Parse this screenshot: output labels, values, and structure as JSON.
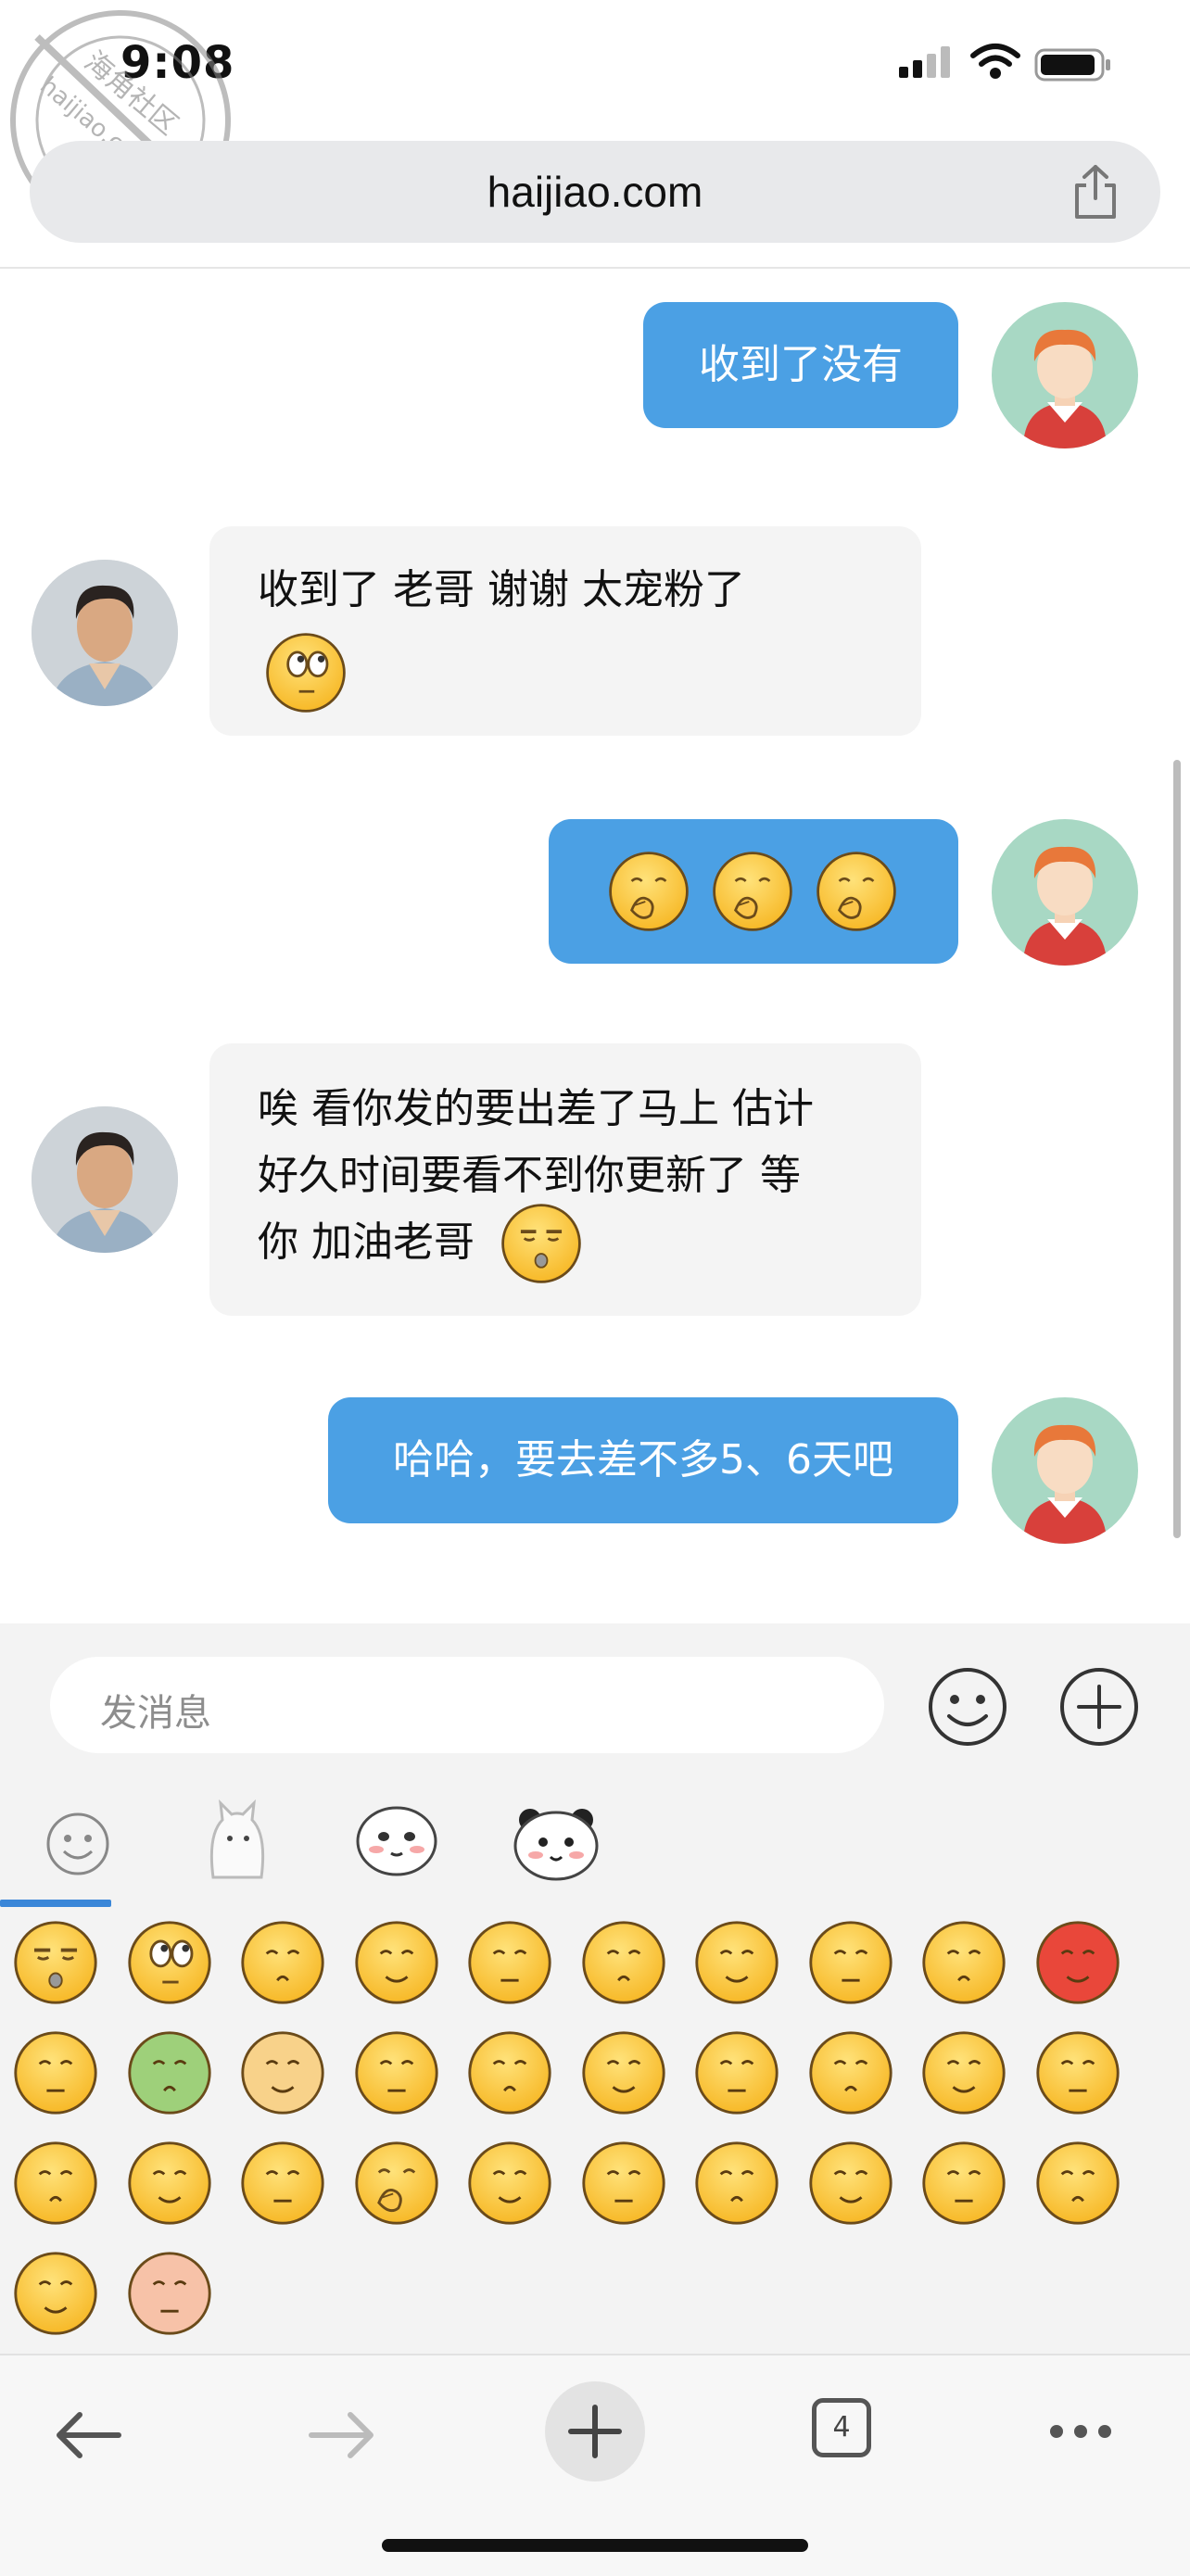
{
  "status_bar": {
    "time": "9:08"
  },
  "watermark": {
    "text": "海角社区 haijiao.com"
  },
  "browser": {
    "url": "haijiao.com",
    "tab_count": "4"
  },
  "messages": [
    {
      "from": "me",
      "text": "收到了没有",
      "emojis": []
    },
    {
      "from": "them",
      "text": "收到了 老哥 谢谢 太宠粉了",
      "emojis": [
        "rolling-eyes-emoji"
      ]
    },
    {
      "from": "me",
      "text": "",
      "emojis": [
        "shy-laugh-emoji",
        "shy-laugh-emoji",
        "shy-laugh-emoji"
      ]
    },
    {
      "from": "them",
      "text_lines": [
        "唉 看你发的要出差了马上 估计",
        "好久时间要看不到你更新了 等",
        "你 加油老哥"
      ],
      "emojis": [
        "sleepy-emoji"
      ]
    },
    {
      "from": "me",
      "text": "哈哈，要去差不多5、6天吧",
      "emojis": []
    }
  ],
  "composer": {
    "placeholder": "发消息"
  },
  "emoji_tabs": [
    "smiley-tab-icon",
    "cat-sticker-tab-icon",
    "round-face-tab-icon",
    "panda-tab-icon"
  ],
  "emoji_grid": [
    "sleepy-emoji",
    "rolling-eyes-emoji",
    "thinking-emoji",
    "cold-hands-emoji",
    "crying-emoji",
    "blush-emoji",
    "curious-emoji",
    "sunglasses-emoji",
    "grin-emoji",
    "angry-emoji",
    "nervous-emoji",
    "dizzy-emoji",
    "cat-emoji",
    "grinning-teeth-emoji",
    "squint-emoji",
    "stunned-emoji",
    "shocked-emoji",
    "surprised-emoji",
    "awkward-emoji",
    "sweat-smile-emoji",
    "kiss-emoji",
    "heart-eyes-emoji",
    "wink-emoji",
    "shy-laugh-emoji",
    "sneeze-emoji",
    "sweat-emoji",
    "laugh-cry-emoji",
    "smirk-emoji",
    "confused-emoji",
    "spiral-eyes-emoji",
    "happy-blush-emoji",
    "pig-emoji"
  ]
}
